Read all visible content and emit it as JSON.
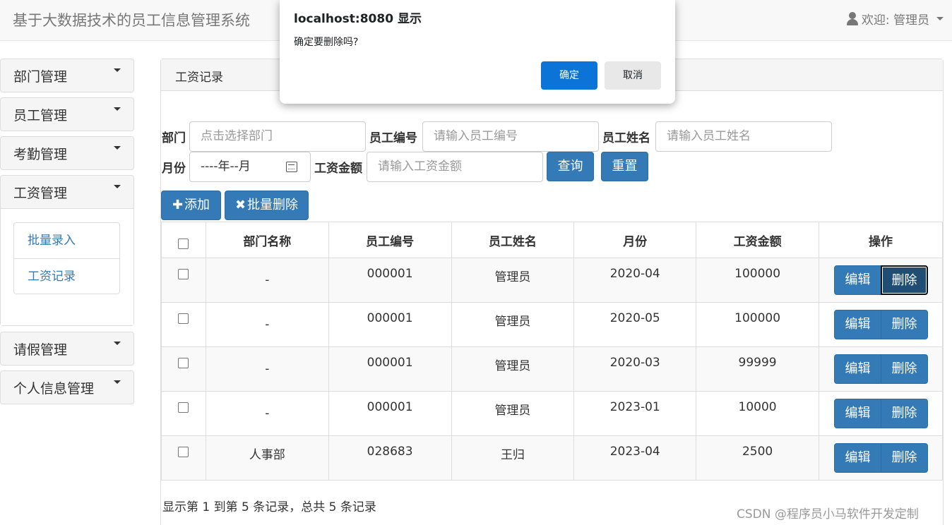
{
  "navbar": {
    "brand": "基于大数据技术的员工信息管理系统",
    "user_label": "欢迎: 管理员"
  },
  "sidebar": {
    "menus": [
      {
        "label": "部门管理"
      },
      {
        "label": "员工管理"
      },
      {
        "label": "考勤管理"
      },
      {
        "label": "工资管理",
        "expanded": true,
        "items": [
          {
            "label": "批量录入"
          },
          {
            "label": "工资记录"
          }
        ]
      },
      {
        "label": "请假管理"
      },
      {
        "label": "个人信息管理"
      }
    ]
  },
  "main": {
    "title": "工资记录",
    "filters": {
      "dept_label": "部门",
      "dept_placeholder": "点击选择部门",
      "empno_label": "员工编号",
      "empno_placeholder": "请输入员工编号",
      "empname_label": "员工姓名",
      "empname_placeholder": "请输入员工姓名",
      "month_label": "月份",
      "month_value": "----年--月",
      "salary_label": "工资金额",
      "salary_placeholder": "请输入工资金额",
      "search_button": "查询",
      "reset_button": "重置"
    },
    "actions": {
      "add_icon": "plus-icon",
      "add_label": "添加",
      "batch_delete_icon": "cross-icon",
      "batch_delete_label": "批量删除"
    },
    "table": {
      "headers": [
        "部门名称",
        "员工编号",
        "员工姓名",
        "月份",
        "工资金额",
        "操作"
      ],
      "rows": [
        {
          "dept": "-",
          "empno": "000001",
          "name": "管理员",
          "month": "2020-04",
          "salary": "100000"
        },
        {
          "dept": "-",
          "empno": "000001",
          "name": "管理员",
          "month": "2020-05",
          "salary": "100000"
        },
        {
          "dept": "-",
          "empno": "000001",
          "name": "管理员",
          "month": "2020-03",
          "salary": "99999"
        },
        {
          "dept": "-",
          "empno": "000001",
          "name": "管理员",
          "month": "2023-01",
          "salary": "10000"
        },
        {
          "dept": "人事部",
          "empno": "028683",
          "name": "王归",
          "month": "2023-04",
          "salary": "2500"
        }
      ],
      "edit_label": "编辑",
      "delete_label": "删除"
    },
    "footer": "显示第 1 到第 5 条记录，总共 5 条记录"
  },
  "watermark": "CSDN @程序员小马软件开发定制",
  "dialog": {
    "title": "localhost:8080 显示",
    "message": "确定要删除吗?",
    "ok_label": "确定",
    "cancel_label": "取消"
  },
  "colors": {
    "primary": "#337ab7",
    "dialog_ok": "#0b74d6"
  }
}
